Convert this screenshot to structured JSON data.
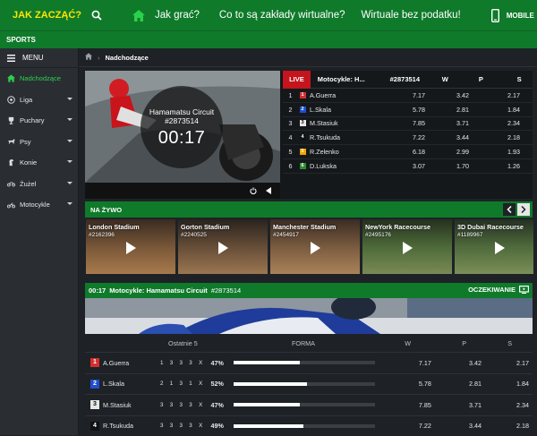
{
  "header": {
    "brand": "JAK ZACZĄĆ?",
    "nav": [
      "Jak grać?",
      "Co to są zakłady wirtualne?",
      "Wirtuale bez podatku!"
    ],
    "mobile": "MOBILE"
  },
  "sports_label": "SPORTS",
  "sidebar": {
    "menu": "MENU",
    "items": [
      {
        "label": "Nadchodzące",
        "icon": "home-icon",
        "active": true
      },
      {
        "label": "Liga",
        "icon": "soccer-ball-icon"
      },
      {
        "label": "Puchary",
        "icon": "trophy-icon"
      },
      {
        "label": "Psy",
        "icon": "dog-icon"
      },
      {
        "label": "Konie",
        "icon": "horse-icon"
      },
      {
        "label": "Żużel",
        "icon": "speedway-icon"
      },
      {
        "label": "Motocykle",
        "icon": "motorcycle-icon"
      }
    ]
  },
  "breadcrumb": "Nadchodzące",
  "race": {
    "venue": "Hamamatsu Circuit",
    "id": "#2873514",
    "time": "00:17",
    "live": "LIVE",
    "title": "Motocykle: H...",
    "cols": [
      "W",
      "P",
      "S"
    ],
    "riders": [
      {
        "n": "1",
        "name": "A.Guerra",
        "w": "7.17",
        "p": "3.42",
        "s": "2.17",
        "color": "#d32f2f"
      },
      {
        "n": "2",
        "name": "L.Skala",
        "w": "5.78",
        "p": "2.81",
        "s": "1.84",
        "color": "#1f4fcf"
      },
      {
        "n": "3",
        "name": "M.Stasiuk",
        "w": "7.85",
        "p": "3.71",
        "s": "2.34",
        "color": "#e6e6e6"
      },
      {
        "n": "4",
        "name": "R.Tsukuda",
        "w": "7.22",
        "p": "3.44",
        "s": "2.18",
        "color": "#111111"
      },
      {
        "n": "5",
        "name": "R.Zelenko",
        "w": "6.18",
        "p": "2.99",
        "s": "1.93",
        "color": "#f2a400"
      },
      {
        "n": "6",
        "name": "D.Lukska",
        "w": "3.07",
        "p": "1.70",
        "s": "1.26",
        "color": "#2e8b2e"
      }
    ]
  },
  "live_now": {
    "title": "NA ŻYWO",
    "streams": [
      {
        "name": "London Stadium",
        "id": "#2162396"
      },
      {
        "name": "Gorton Stadium",
        "id": "#2240525"
      },
      {
        "name": "Manchester Stadium",
        "id": "#2454917"
      },
      {
        "name": "NewYork Racecourse",
        "id": "#2495176"
      },
      {
        "name": "3D Dubai Racecourse",
        "id": "#1189967"
      }
    ]
  },
  "race_detail": {
    "time": "00:17",
    "title": "Motocykle: Hamamatsu Circuit",
    "id": "#2873514",
    "status": "OCZEKIWANIE",
    "cols": {
      "last": "Ostatnie 5",
      "form": "FORMA",
      "w": "W",
      "p": "P",
      "s": "S"
    },
    "rows": [
      {
        "n": "1",
        "name": "A.Guerra",
        "last": "1 3 3 3 X",
        "pct": "47%",
        "form": 0.47,
        "w": "7.17",
        "p": "3.42",
        "s": "2.17",
        "color": "#d32f2f"
      },
      {
        "n": "2",
        "name": "L.Skala",
        "last": "2 1 3 1 X",
        "pct": "52%",
        "form": 0.52,
        "w": "5.78",
        "p": "2.81",
        "s": "1.84",
        "color": "#1f4fcf"
      },
      {
        "n": "3",
        "name": "M.Stasiuk",
        "last": "3 3 3 3 X",
        "pct": "47%",
        "form": 0.47,
        "w": "7.85",
        "p": "3.71",
        "s": "2.34",
        "color": "#e6e6e6"
      },
      {
        "n": "4",
        "name": "R.Tsukuda",
        "last": "3 3 3 3 X",
        "pct": "49%",
        "form": 0.49,
        "w": "7.22",
        "p": "3.44",
        "s": "2.18",
        "color": "#111111"
      }
    ]
  }
}
